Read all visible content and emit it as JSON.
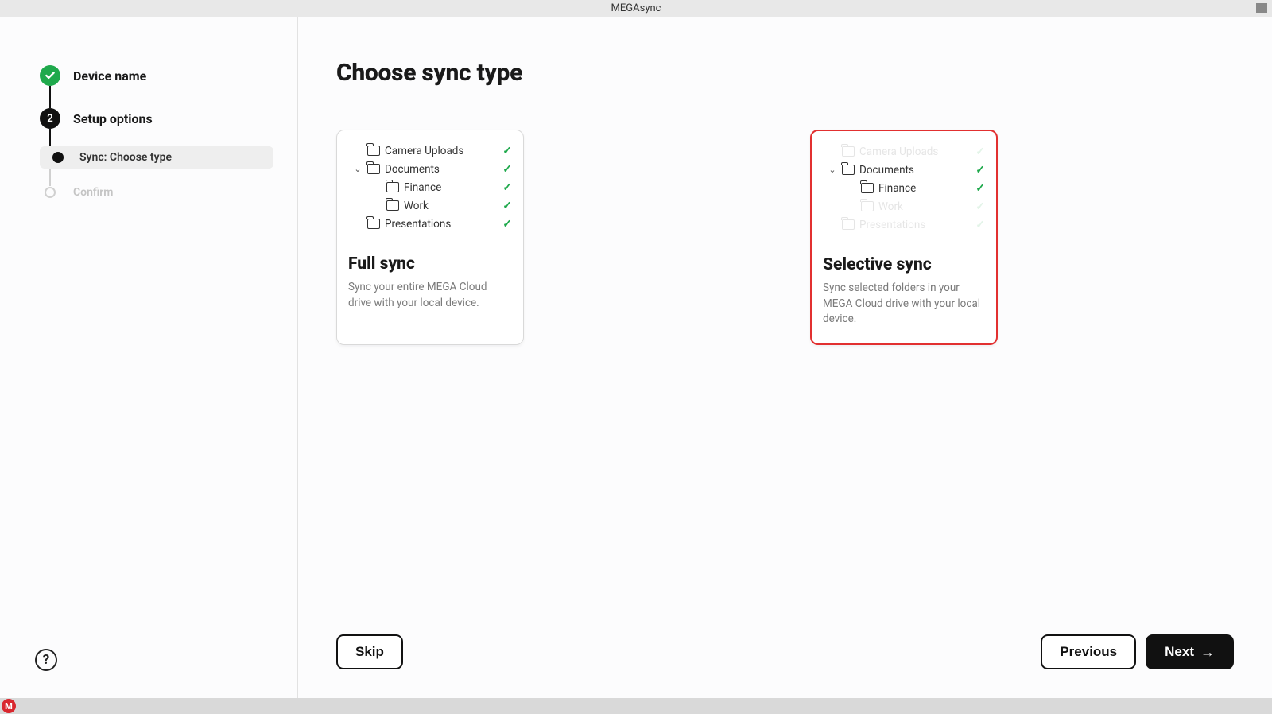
{
  "window": {
    "title": "MEGAsync"
  },
  "stepper": {
    "step1": {
      "label": "Device name"
    },
    "step2": {
      "number": "2",
      "label": "Setup options"
    },
    "sub1": {
      "label": "Sync: Choose type"
    },
    "sub2": {
      "label": "Confirm"
    }
  },
  "page": {
    "title": "Choose sync type"
  },
  "full_sync": {
    "title": "Full sync",
    "desc": "Sync your entire MEGA Cloud drive with your local device.",
    "tree": {
      "r0": "Camera Uploads",
      "r1": "Documents",
      "r2": "Finance",
      "r3": "Work",
      "r4": "Presentations"
    }
  },
  "selective_sync": {
    "title": "Selective sync",
    "desc": "Sync selected folders in your MEGA Cloud drive with your local device.",
    "tree": {
      "r0": "Camera Uploads",
      "r1": "Documents",
      "r2": "Finance",
      "r3": "Work",
      "r4": "Presentations"
    }
  },
  "buttons": {
    "skip": "Skip",
    "previous": "Previous",
    "next": "Next"
  },
  "taskbar": {
    "badge": "M"
  }
}
